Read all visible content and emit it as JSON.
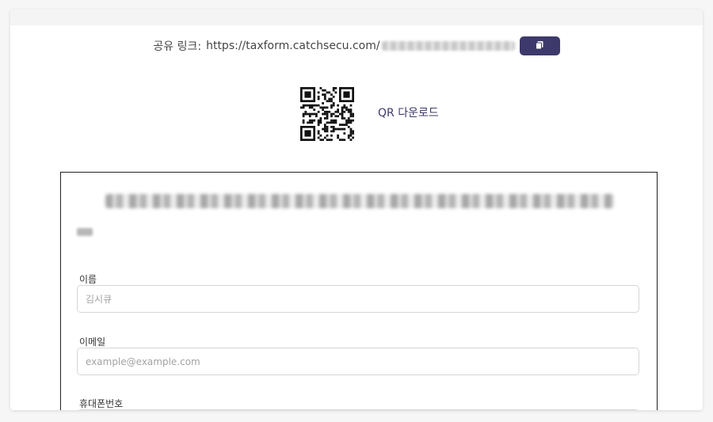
{
  "share": {
    "label": "공유 링크:",
    "url_prefix": "https://taxform.catchsecu.com/"
  },
  "qr": {
    "download_label": "QR 다운로드"
  },
  "form": {
    "fields": [
      {
        "label": "이름",
        "placeholder": "김시큐"
      },
      {
        "label": "이메일",
        "placeholder": "example@example.com"
      },
      {
        "label": "휴대폰번호",
        "placeholder": ""
      }
    ]
  },
  "colors": {
    "accent": "#3d3a6b",
    "border": "#222222",
    "input_border": "#d6d6d6"
  },
  "icons": {
    "copy": "copy-icon",
    "qr": "qr-code"
  }
}
